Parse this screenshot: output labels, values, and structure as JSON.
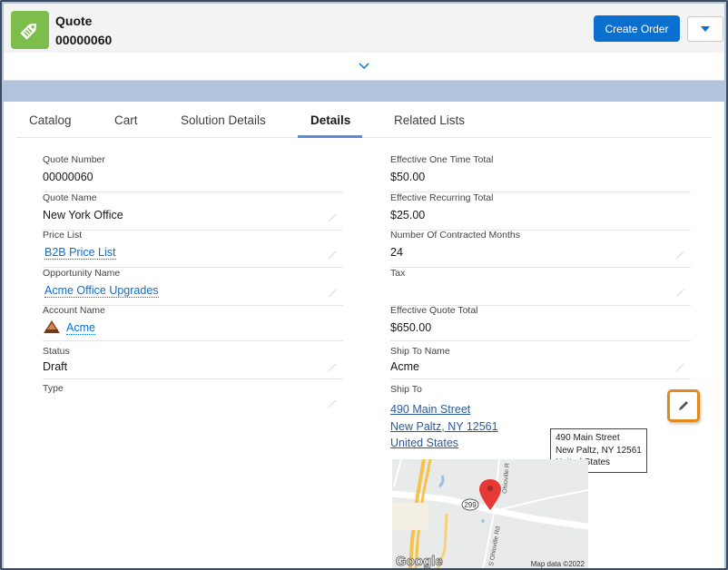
{
  "header": {
    "object_label": "Quote",
    "record_name": "00000060",
    "icon": "price-tag-icon",
    "primary_action": "Create Order",
    "more_actions_icon": "caret-down-icon",
    "expand_icon": "chevron-down-icon"
  },
  "tabs": [
    {
      "label": "Catalog",
      "active": false
    },
    {
      "label": "Cart",
      "active": false
    },
    {
      "label": "Solution Details",
      "active": false
    },
    {
      "label": "Details",
      "active": true
    },
    {
      "label": "Related Lists",
      "active": false
    }
  ],
  "left_fields": [
    {
      "label": "Quote Number",
      "value": "00000060",
      "editable": false
    },
    {
      "label": "Quote Name",
      "value": "New York Office",
      "editable": true
    },
    {
      "label": "Price List",
      "value": "B2B Price List",
      "link": true,
      "editable": true
    },
    {
      "label": "Opportunity Name",
      "value": "Acme Office Upgrades",
      "link": true,
      "editable": true
    },
    {
      "label": "Account Name",
      "value": "Acme",
      "link": true,
      "editable": false,
      "icon": "account-logo-icon"
    },
    {
      "label": "Status",
      "value": "Draft",
      "editable": true
    },
    {
      "label": "Type",
      "value": "",
      "editable": true
    }
  ],
  "right_fields": [
    {
      "label": "Effective One Time Total",
      "value": "$50.00",
      "editable": false
    },
    {
      "label": "Effective Recurring Total",
      "value": "$25.00",
      "editable": false
    },
    {
      "label": "Number Of Contracted Months",
      "value": "24",
      "editable": true
    },
    {
      "label": "Tax",
      "value": "",
      "editable": true
    },
    {
      "label": "Effective Quote Total",
      "value": "$650.00",
      "editable": false
    },
    {
      "label": "Ship To Name",
      "value": "Acme",
      "editable": true
    }
  ],
  "ship_to": {
    "label": "Ship To",
    "street": "490 Main Street",
    "city_line": "New Paltz, NY 12561",
    "country": "United States",
    "tooltip": [
      "490 Main Street",
      "New Paltz, NY 12561",
      "United States"
    ]
  },
  "map": {
    "route_shield": "299",
    "road_label_1": "S Ohioville Rd",
    "road_label_2": "Ohioville R",
    "brand": "Google",
    "attribution": "Map data ©2022",
    "marker_color": "#e53935"
  },
  "colors": {
    "brand_blue": "#0b6fd0",
    "icon_green": "#7dbd4c",
    "highlight_orange": "#e08a1e"
  }
}
